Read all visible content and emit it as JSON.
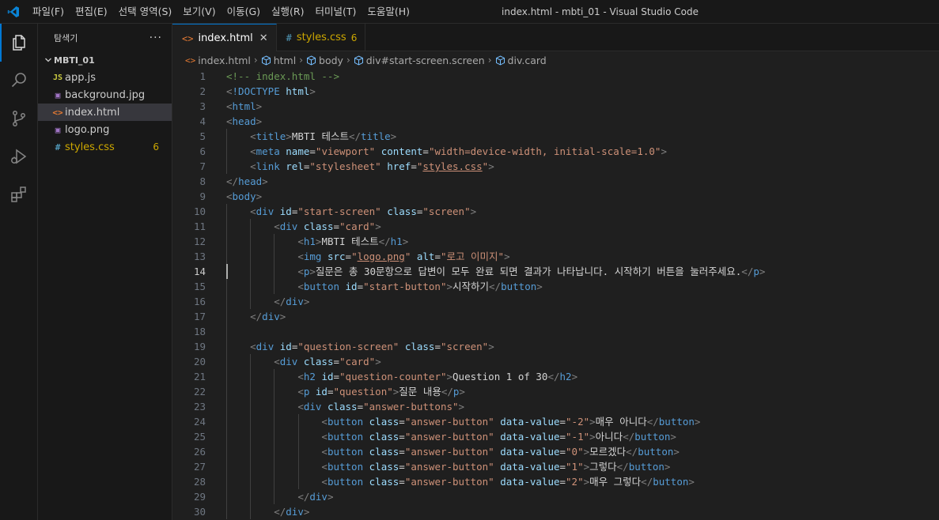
{
  "window": {
    "title": "index.html - mbti_01 - Visual Studio Code"
  },
  "menu": [
    "파일(F)",
    "편집(E)",
    "선택 영역(S)",
    "보기(V)",
    "이동(G)",
    "실행(R)",
    "터미널(T)",
    "도움말(H)"
  ],
  "activity_bar": [
    "explorer-icon",
    "search-icon",
    "source-control-icon",
    "run-debug-icon",
    "extensions-icon"
  ],
  "sidebar": {
    "title": "탐색기",
    "more": "···",
    "folder": "MBTI_01",
    "files": [
      {
        "icon": "JS",
        "icon_color": "#cbcb41",
        "name": "app.js",
        "badge": ""
      },
      {
        "icon": "▣",
        "icon_color": "#a074c4",
        "name": "background.jpg",
        "badge": ""
      },
      {
        "icon": "<>",
        "icon_color": "#e37933",
        "name": "index.html",
        "badge": ""
      },
      {
        "icon": "▣",
        "icon_color": "#a074c4",
        "name": "logo.png",
        "badge": ""
      },
      {
        "icon": "#",
        "icon_color": "#519aba",
        "name": "styles.css",
        "badge": "6"
      }
    ]
  },
  "tabs": [
    {
      "icon": "<>",
      "label": "index.html",
      "close": "✕",
      "badge": ""
    },
    {
      "icon": "#",
      "label": "styles.css",
      "close": "",
      "badge": "6"
    }
  ],
  "breadcrumb": [
    "index.html",
    "html",
    "body",
    "div#start-screen.screen",
    "div.card"
  ],
  "editor": {
    "current_line": 14,
    "colors": {
      "comment": "#6a9955",
      "tag": "#569cd6",
      "bracket": "#808080",
      "attr": "#9cdcfe",
      "string": "#ce9178",
      "text": "#d4d4d4"
    },
    "lines": [
      {
        "n": "1",
        "indent": 0,
        "tokens": [
          [
            "c",
            "<!-- index.html -->"
          ]
        ]
      },
      {
        "n": "2",
        "indent": 0,
        "tokens": [
          [
            "b",
            "<"
          ],
          [
            "t",
            "!DOCTYPE"
          ],
          [
            "x",
            " "
          ],
          [
            "a",
            "html"
          ],
          [
            "b",
            ">"
          ]
        ]
      },
      {
        "n": "3",
        "indent": 0,
        "tokens": [
          [
            "b",
            "<"
          ],
          [
            "t",
            "html"
          ],
          [
            "b",
            ">"
          ]
        ]
      },
      {
        "n": "4",
        "indent": 0,
        "tokens": [
          [
            "b",
            "<"
          ],
          [
            "t",
            "head"
          ],
          [
            "b",
            ">"
          ]
        ]
      },
      {
        "n": "5",
        "indent": 1,
        "tokens": [
          [
            "b",
            "<"
          ],
          [
            "t",
            "title"
          ],
          [
            "b",
            ">"
          ],
          [
            "x",
            "MBTI 테스트"
          ],
          [
            "b",
            "</"
          ],
          [
            "t",
            "title"
          ],
          [
            "b",
            ">"
          ]
        ]
      },
      {
        "n": "6",
        "indent": 1,
        "tokens": [
          [
            "b",
            "<"
          ],
          [
            "t",
            "meta"
          ],
          [
            "x",
            " "
          ],
          [
            "a",
            "name"
          ],
          [
            "x",
            "="
          ],
          [
            "s",
            "\"viewport\""
          ],
          [
            "x",
            " "
          ],
          [
            "a",
            "content"
          ],
          [
            "x",
            "="
          ],
          [
            "s",
            "\"width=device-width, initial-scale=1.0\""
          ],
          [
            "b",
            ">"
          ]
        ]
      },
      {
        "n": "7",
        "indent": 1,
        "tokens": [
          [
            "b",
            "<"
          ],
          [
            "t",
            "link"
          ],
          [
            "x",
            " "
          ],
          [
            "a",
            "rel"
          ],
          [
            "x",
            "="
          ],
          [
            "s",
            "\"stylesheet\""
          ],
          [
            "x",
            " "
          ],
          [
            "a",
            "href"
          ],
          [
            "x",
            "="
          ],
          [
            "s",
            "\""
          ],
          [
            "u",
            "styles.css"
          ],
          [
            "s",
            "\""
          ],
          [
            "b",
            ">"
          ]
        ]
      },
      {
        "n": "8",
        "indent": 0,
        "tokens": [
          [
            "b",
            "</"
          ],
          [
            "t",
            "head"
          ],
          [
            "b",
            ">"
          ]
        ]
      },
      {
        "n": "9",
        "indent": 0,
        "tokens": [
          [
            "b",
            "<"
          ],
          [
            "t",
            "body"
          ],
          [
            "b",
            ">"
          ]
        ]
      },
      {
        "n": "10",
        "indent": 1,
        "tokens": [
          [
            "b",
            "<"
          ],
          [
            "t",
            "div"
          ],
          [
            "x",
            " "
          ],
          [
            "a",
            "id"
          ],
          [
            "x",
            "="
          ],
          [
            "s",
            "\"start-screen\""
          ],
          [
            "x",
            " "
          ],
          [
            "a",
            "class"
          ],
          [
            "x",
            "="
          ],
          [
            "s",
            "\"screen\""
          ],
          [
            "b",
            ">"
          ]
        ]
      },
      {
        "n": "11",
        "indent": 2,
        "tokens": [
          [
            "b",
            "<"
          ],
          [
            "t",
            "div"
          ],
          [
            "x",
            " "
          ],
          [
            "a",
            "class"
          ],
          [
            "x",
            "="
          ],
          [
            "s",
            "\"card\""
          ],
          [
            "b",
            ">"
          ]
        ]
      },
      {
        "n": "12",
        "indent": 3,
        "tokens": [
          [
            "b",
            "<"
          ],
          [
            "t",
            "h1"
          ],
          [
            "b",
            ">"
          ],
          [
            "x",
            "MBTI 테스트"
          ],
          [
            "b",
            "</"
          ],
          [
            "t",
            "h1"
          ],
          [
            "b",
            ">"
          ]
        ]
      },
      {
        "n": "13",
        "indent": 3,
        "tokens": [
          [
            "b",
            "<"
          ],
          [
            "t",
            "img"
          ],
          [
            "x",
            " "
          ],
          [
            "a",
            "src"
          ],
          [
            "x",
            "="
          ],
          [
            "s",
            "\""
          ],
          [
            "u",
            "logo.png"
          ],
          [
            "s",
            "\""
          ],
          [
            "x",
            " "
          ],
          [
            "a",
            "alt"
          ],
          [
            "x",
            "="
          ],
          [
            "s",
            "\"로고 이미지\""
          ],
          [
            "b",
            ">"
          ]
        ]
      },
      {
        "n": "14",
        "indent": 3,
        "tokens": [
          [
            "b",
            "<"
          ],
          [
            "t",
            "p"
          ],
          [
            "b",
            ">"
          ],
          [
            "x",
            "질문은 총 30문항으로 답변이 모두 완료 되면 결과가 나타납니다. 시작하기 버튼을 눌러주세요."
          ],
          [
            "b",
            "</"
          ],
          [
            "t",
            "p"
          ],
          [
            "b",
            ">"
          ]
        ]
      },
      {
        "n": "15",
        "indent": 3,
        "tokens": [
          [
            "b",
            "<"
          ],
          [
            "t",
            "button"
          ],
          [
            "x",
            " "
          ],
          [
            "a",
            "id"
          ],
          [
            "x",
            "="
          ],
          [
            "s",
            "\"start-button\""
          ],
          [
            "b",
            ">"
          ],
          [
            "x",
            "시작하기"
          ],
          [
            "b",
            "</"
          ],
          [
            "t",
            "button"
          ],
          [
            "b",
            ">"
          ]
        ]
      },
      {
        "n": "16",
        "indent": 2,
        "tokens": [
          [
            "b",
            "</"
          ],
          [
            "t",
            "div"
          ],
          [
            "b",
            ">"
          ]
        ]
      },
      {
        "n": "17",
        "indent": 1,
        "tokens": [
          [
            "b",
            "</"
          ],
          [
            "t",
            "div"
          ],
          [
            "b",
            ">"
          ]
        ]
      },
      {
        "n": "18",
        "indent": 0,
        "tokens": []
      },
      {
        "n": "19",
        "indent": 1,
        "tokens": [
          [
            "b",
            "<"
          ],
          [
            "t",
            "div"
          ],
          [
            "x",
            " "
          ],
          [
            "a",
            "id"
          ],
          [
            "x",
            "="
          ],
          [
            "s",
            "\"question-screen\""
          ],
          [
            "x",
            " "
          ],
          [
            "a",
            "class"
          ],
          [
            "x",
            "="
          ],
          [
            "s",
            "\"screen\""
          ],
          [
            "b",
            ">"
          ]
        ]
      },
      {
        "n": "20",
        "indent": 2,
        "tokens": [
          [
            "b",
            "<"
          ],
          [
            "t",
            "div"
          ],
          [
            "x",
            " "
          ],
          [
            "a",
            "class"
          ],
          [
            "x",
            "="
          ],
          [
            "s",
            "\"card\""
          ],
          [
            "b",
            ">"
          ]
        ]
      },
      {
        "n": "21",
        "indent": 3,
        "tokens": [
          [
            "b",
            "<"
          ],
          [
            "t",
            "h2"
          ],
          [
            "x",
            " "
          ],
          [
            "a",
            "id"
          ],
          [
            "x",
            "="
          ],
          [
            "s",
            "\"question-counter\""
          ],
          [
            "b",
            ">"
          ],
          [
            "x",
            "Question 1 of 30"
          ],
          [
            "b",
            "</"
          ],
          [
            "t",
            "h2"
          ],
          [
            "b",
            ">"
          ]
        ]
      },
      {
        "n": "22",
        "indent": 3,
        "tokens": [
          [
            "b",
            "<"
          ],
          [
            "t",
            "p"
          ],
          [
            "x",
            " "
          ],
          [
            "a",
            "id"
          ],
          [
            "x",
            "="
          ],
          [
            "s",
            "\"question\""
          ],
          [
            "b",
            ">"
          ],
          [
            "x",
            "질문 내용"
          ],
          [
            "b",
            "</"
          ],
          [
            "t",
            "p"
          ],
          [
            "b",
            ">"
          ]
        ]
      },
      {
        "n": "23",
        "indent": 3,
        "tokens": [
          [
            "b",
            "<"
          ],
          [
            "t",
            "div"
          ],
          [
            "x",
            " "
          ],
          [
            "a",
            "class"
          ],
          [
            "x",
            "="
          ],
          [
            "s",
            "\"answer-buttons\""
          ],
          [
            "b",
            ">"
          ]
        ]
      },
      {
        "n": "24",
        "indent": 4,
        "tokens": [
          [
            "b",
            "<"
          ],
          [
            "t",
            "button"
          ],
          [
            "x",
            " "
          ],
          [
            "a",
            "class"
          ],
          [
            "x",
            "="
          ],
          [
            "s",
            "\"answer-button\""
          ],
          [
            "x",
            " "
          ],
          [
            "a",
            "data-value"
          ],
          [
            "x",
            "="
          ],
          [
            "s",
            "\"-2\""
          ],
          [
            "b",
            ">"
          ],
          [
            "x",
            "매우 아니다"
          ],
          [
            "b",
            "</"
          ],
          [
            "t",
            "button"
          ],
          [
            "b",
            ">"
          ]
        ]
      },
      {
        "n": "25",
        "indent": 4,
        "tokens": [
          [
            "b",
            "<"
          ],
          [
            "t",
            "button"
          ],
          [
            "x",
            " "
          ],
          [
            "a",
            "class"
          ],
          [
            "x",
            "="
          ],
          [
            "s",
            "\"answer-button\""
          ],
          [
            "x",
            " "
          ],
          [
            "a",
            "data-value"
          ],
          [
            "x",
            "="
          ],
          [
            "s",
            "\"-1\""
          ],
          [
            "b",
            ">"
          ],
          [
            "x",
            "아니다"
          ],
          [
            "b",
            "</"
          ],
          [
            "t",
            "button"
          ],
          [
            "b",
            ">"
          ]
        ]
      },
      {
        "n": "26",
        "indent": 4,
        "tokens": [
          [
            "b",
            "<"
          ],
          [
            "t",
            "button"
          ],
          [
            "x",
            " "
          ],
          [
            "a",
            "class"
          ],
          [
            "x",
            "="
          ],
          [
            "s",
            "\"answer-button\""
          ],
          [
            "x",
            " "
          ],
          [
            "a",
            "data-value"
          ],
          [
            "x",
            "="
          ],
          [
            "s",
            "\"0\""
          ],
          [
            "b",
            ">"
          ],
          [
            "x",
            "모르겠다"
          ],
          [
            "b",
            "</"
          ],
          [
            "t",
            "button"
          ],
          [
            "b",
            ">"
          ]
        ]
      },
      {
        "n": "27",
        "indent": 4,
        "tokens": [
          [
            "b",
            "<"
          ],
          [
            "t",
            "button"
          ],
          [
            "x",
            " "
          ],
          [
            "a",
            "class"
          ],
          [
            "x",
            "="
          ],
          [
            "s",
            "\"answer-button\""
          ],
          [
            "x",
            " "
          ],
          [
            "a",
            "data-value"
          ],
          [
            "x",
            "="
          ],
          [
            "s",
            "\"1\""
          ],
          [
            "b",
            ">"
          ],
          [
            "x",
            "그렇다"
          ],
          [
            "b",
            "</"
          ],
          [
            "t",
            "button"
          ],
          [
            "b",
            ">"
          ]
        ]
      },
      {
        "n": "28",
        "indent": 4,
        "tokens": [
          [
            "b",
            "<"
          ],
          [
            "t",
            "button"
          ],
          [
            "x",
            " "
          ],
          [
            "a",
            "class"
          ],
          [
            "x",
            "="
          ],
          [
            "s",
            "\"answer-button\""
          ],
          [
            "x",
            " "
          ],
          [
            "a",
            "data-value"
          ],
          [
            "x",
            "="
          ],
          [
            "s",
            "\"2\""
          ],
          [
            "b",
            ">"
          ],
          [
            "x",
            "매우 그렇다"
          ],
          [
            "b",
            "</"
          ],
          [
            "t",
            "button"
          ],
          [
            "b",
            ">"
          ]
        ]
      },
      {
        "n": "29",
        "indent": 3,
        "tokens": [
          [
            "b",
            "</"
          ],
          [
            "t",
            "div"
          ],
          [
            "b",
            ">"
          ]
        ]
      },
      {
        "n": "30",
        "indent": 2,
        "tokens": [
          [
            "b",
            "</"
          ],
          [
            "t",
            "div"
          ],
          [
            "b",
            ">"
          ]
        ]
      }
    ]
  }
}
